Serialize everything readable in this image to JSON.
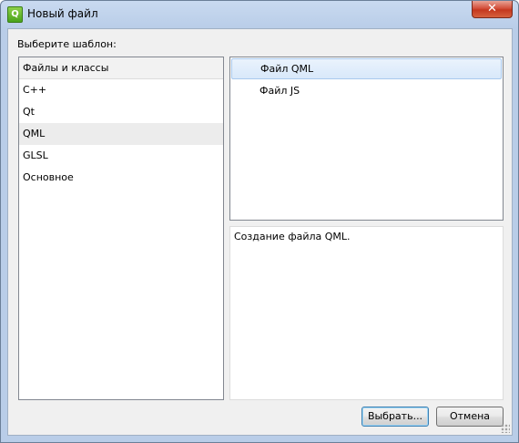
{
  "window": {
    "title": "Новый файл",
    "icon": "qt-creator-icon",
    "close_symbol": "✕"
  },
  "dialog": {
    "prompt": "Выберите шаблон:",
    "categories": {
      "header": "Файлы и классы",
      "items": [
        "C++",
        "Qt",
        "QML",
        "GLSL",
        "Основное"
      ],
      "selected": "QML"
    },
    "templates": {
      "items": [
        "Файл QML",
        "Файл JS"
      ],
      "selected": "Файл QML"
    },
    "description": "Создание файла QML.",
    "buttons": {
      "choose_label": "Выбрать...",
      "cancel_label": "Отмена"
    }
  },
  "colors": {
    "accent": "#3c7fb1",
    "selection": "#d8e8fa",
    "close": "#c4381f"
  }
}
